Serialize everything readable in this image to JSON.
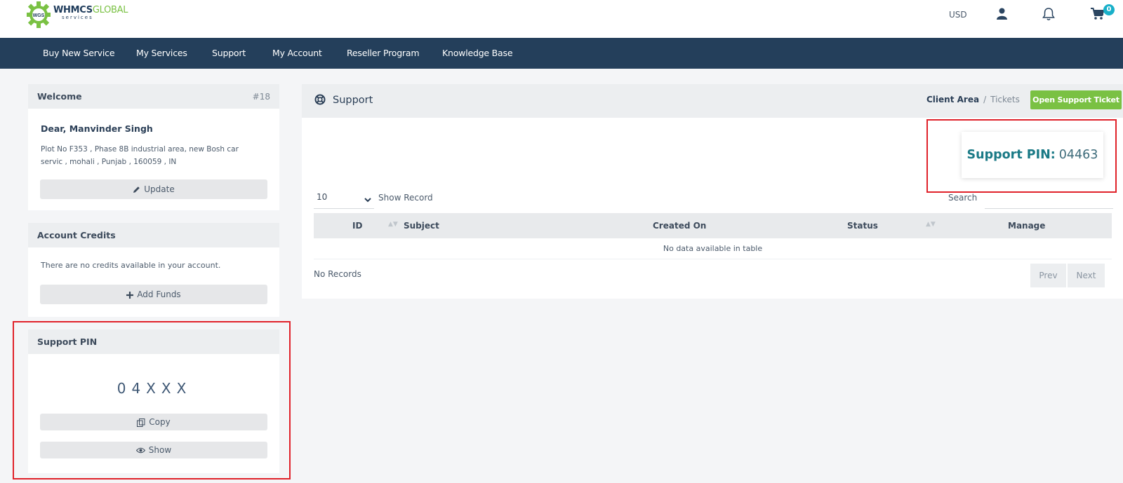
{
  "header": {
    "logo_main": "WHMCS",
    "logo_accent": "GLOBAL",
    "logo_sub": "services",
    "logo_badge": "WGS",
    "currency": "USD",
    "cart_count": "0",
    "icons": [
      "user-icon",
      "bell-icon",
      "cart-icon"
    ]
  },
  "nav": {
    "items": [
      {
        "label": "Buy New Service"
      },
      {
        "label": "My Services"
      },
      {
        "label": "Support"
      },
      {
        "label": "My Account"
      },
      {
        "label": "Reseller Program"
      },
      {
        "label": "Knowledge Base"
      }
    ]
  },
  "sidebar": {
    "welcome": {
      "title": "Welcome",
      "number": "#18",
      "greeting": "Dear, Manvinder Singh",
      "address": "Plot No F353 , Phase 8B industrial area, new Bosh car servic , mohali , Punjab , 160059 , IN",
      "update_label": "Update"
    },
    "credits": {
      "title": "Account Credits",
      "text": "There are no credits available in your account.",
      "add_funds_label": "Add Funds"
    },
    "pin": {
      "title": "Support PIN",
      "masked": "04XXX",
      "copy_label": "Copy",
      "show_label": "Show"
    }
  },
  "main": {
    "title": "Support",
    "breadcrumb": {
      "link": "Client Area",
      "separator": "/",
      "current": "Tickets"
    },
    "open_ticket_label": "Open Support Ticket",
    "pin_card": {
      "label": "Support PIN:",
      "value": "04463"
    },
    "table": {
      "length_value": "10",
      "show_record_label": "Show Record",
      "search_label": "Search",
      "search_value": "",
      "columns": [
        "ID",
        "Subject",
        "Created On",
        "Status",
        "Manage"
      ],
      "empty_text": "No data available in table",
      "info": "No Records",
      "prev_label": "Prev",
      "next_label": "Next"
    }
  },
  "colors": {
    "nav_bg": "#243f5b",
    "accent_green": "#7ac143",
    "badge_teal": "#19b0c9",
    "highlight_red": "#e0222a",
    "pin_teal": "#1a7a86"
  }
}
